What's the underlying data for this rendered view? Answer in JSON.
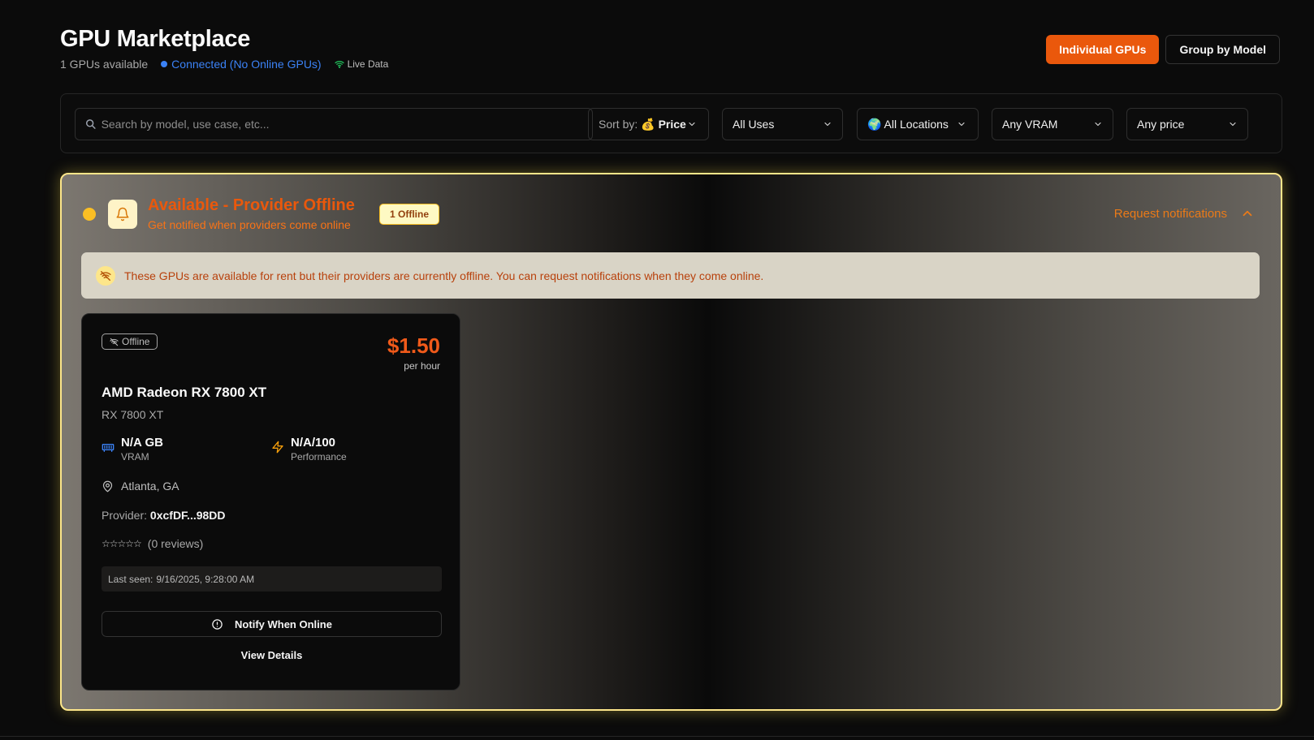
{
  "header": {
    "title": "GPU Marketplace",
    "count_text": "1 GPUs available",
    "connection_status": "Connected (No Online GPUs)",
    "live_label": "Live Data",
    "individual_label": "Individual GPUs",
    "group_label": "Group by Model"
  },
  "filters": {
    "search_placeholder": "Search by model, use case, etc...",
    "sort_prefix": "Sort by:",
    "sort_value": "💰 Price",
    "uses": "All Uses",
    "locations": "🌍 All Locations",
    "vram": "Any VRAM",
    "price": "Any price"
  },
  "offline_section": {
    "title": "Available - Provider Offline",
    "subtitle": "Get notified when providers come online",
    "badge": "1 Offline",
    "request_label": "Request notifications",
    "banner_text": "These GPUs are available for rent but their providers are currently offline. You can request notifications when they come online."
  },
  "gpu_card": {
    "status": "Offline",
    "price": "$1.50",
    "price_unit": "per hour",
    "name": "AMD Radeon RX 7800 XT",
    "model": "RX 7800 XT",
    "vram_value": "N/A GB",
    "vram_label": "VRAM",
    "perf_value": "N/A/100",
    "perf_label": "Performance",
    "location": "Atlanta, GA",
    "provider_label": "Provider:",
    "provider_address": "0xcfDF...98DD",
    "rating_stars": 0,
    "reviews": "(0 reviews)",
    "last_seen_label": "Last seen:",
    "last_seen_value": "9/16/2025, 9:28:00 AM",
    "notify_label": "Notify When Online",
    "details_label": "View Details"
  },
  "colors": {
    "accent": "#ea580c",
    "connected": "#3b82f6",
    "live": "#22c55e",
    "warning": "#fbbf24",
    "section_border": "#fde68a"
  }
}
